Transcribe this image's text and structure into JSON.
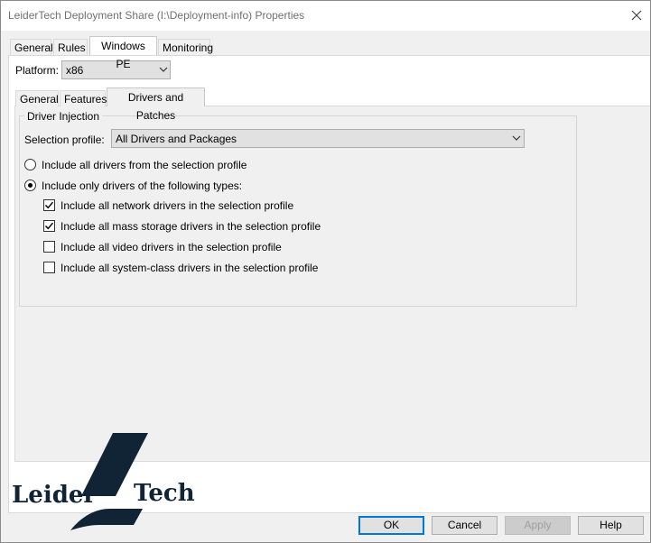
{
  "window": {
    "title": "LeiderTech Deployment Share (I:\\Deployment-info) Properties",
    "close_icon": "close-icon"
  },
  "outer_tabs": [
    "General",
    "Rules",
    "Windows PE",
    "Monitoring"
  ],
  "active_outer_tab": "Windows PE",
  "platform": {
    "label": "Platform:",
    "value": "x86"
  },
  "inner_tabs": [
    "General",
    "Features",
    "Drivers and Patches"
  ],
  "active_inner_tab": "Drivers and Patches",
  "driver_injection": {
    "group_title": "Driver Injection",
    "selection_profile_label": "Selection profile:",
    "selection_profile_value": "All Drivers and Packages",
    "radio_all": {
      "label": "Include all drivers from the selection profile",
      "selected": false
    },
    "radio_only": {
      "label": "Include only drivers of the following types:",
      "selected": true
    },
    "checkboxes": [
      {
        "label": "Include all network drivers in the selection profile",
        "checked": true
      },
      {
        "label": "Include all mass storage drivers in the selection profile",
        "checked": true
      },
      {
        "label": "Include all video drivers in the selection profile",
        "checked": false
      },
      {
        "label": "Include all system-class drivers in the selection profile",
        "checked": false
      }
    ]
  },
  "buttons": {
    "ok": "OK",
    "cancel": "Cancel",
    "apply": "Apply",
    "help": "Help"
  },
  "logo": {
    "left_word": "Leider",
    "right_word": "Tech",
    "color": "#102436"
  },
  "colors": {
    "accent": "#0078d7",
    "window_bg": "#f0f0f0"
  }
}
